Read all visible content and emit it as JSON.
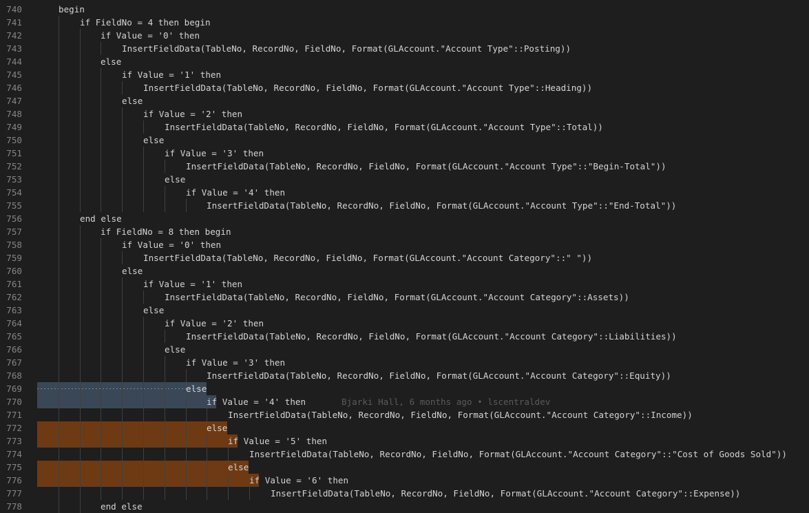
{
  "editor": {
    "lines": [
      {
        "n": "740",
        "indent": 1,
        "text": "begin"
      },
      {
        "n": "741",
        "indent": 2,
        "text": "if FieldNo = 4 then begin"
      },
      {
        "n": "742",
        "indent": 3,
        "text": "if Value = '0' then"
      },
      {
        "n": "743",
        "indent": 4,
        "text": "InsertFieldData(TableNo, RecordNo, FieldNo, Format(GLAccount.\"Account Type\"::Posting))"
      },
      {
        "n": "744",
        "indent": 3,
        "text": "else"
      },
      {
        "n": "745",
        "indent": 4,
        "text": "if Value = '1' then"
      },
      {
        "n": "746",
        "indent": 5,
        "text": "InsertFieldData(TableNo, RecordNo, FieldNo, Format(GLAccount.\"Account Type\"::Heading))"
      },
      {
        "n": "747",
        "indent": 4,
        "text": "else"
      },
      {
        "n": "748",
        "indent": 5,
        "text": "if Value = '2' then"
      },
      {
        "n": "749",
        "indent": 6,
        "text": "InsertFieldData(TableNo, RecordNo, FieldNo, Format(GLAccount.\"Account Type\"::Total))"
      },
      {
        "n": "750",
        "indent": 5,
        "text": "else"
      },
      {
        "n": "751",
        "indent": 6,
        "text": "if Value = '3' then"
      },
      {
        "n": "752",
        "indent": 7,
        "text": "InsertFieldData(TableNo, RecordNo, FieldNo, Format(GLAccount.\"Account Type\"::\"Begin-Total\"))"
      },
      {
        "n": "753",
        "indent": 6,
        "text": "else"
      },
      {
        "n": "754",
        "indent": 7,
        "text": "if Value = '4' then"
      },
      {
        "n": "755",
        "indent": 8,
        "text": "InsertFieldData(TableNo, RecordNo, FieldNo, Format(GLAccount.\"Account Type\"::\"End-Total\"))"
      },
      {
        "n": "756",
        "indent": 2,
        "text": "end else"
      },
      {
        "n": "757",
        "indent": 3,
        "text": "if FieldNo = 8 then begin"
      },
      {
        "n": "758",
        "indent": 4,
        "text": "if Value = '0' then"
      },
      {
        "n": "759",
        "indent": 5,
        "text": "InsertFieldData(TableNo, RecordNo, FieldNo, Format(GLAccount.\"Account Category\"::\" \"))"
      },
      {
        "n": "760",
        "indent": 4,
        "text": "else"
      },
      {
        "n": "761",
        "indent": 5,
        "text": "if Value = '1' then"
      },
      {
        "n": "762",
        "indent": 6,
        "text": "InsertFieldData(TableNo, RecordNo, FieldNo, Format(GLAccount.\"Account Category\"::Assets))"
      },
      {
        "n": "763",
        "indent": 5,
        "text": "else"
      },
      {
        "n": "764",
        "indent": 6,
        "text": "if Value = '2' then"
      },
      {
        "n": "765",
        "indent": 7,
        "text": "InsertFieldData(TableNo, RecordNo, FieldNo, Format(GLAccount.\"Account Category\"::Liabilities))"
      },
      {
        "n": "766",
        "indent": 6,
        "text": "else"
      },
      {
        "n": "767",
        "indent": 7,
        "text": "if Value = '3' then"
      },
      {
        "n": "768",
        "indent": 8,
        "text": "InsertFieldData(TableNo, RecordNo, FieldNo, Format(GLAccount.\"Account Category\"::Equity))"
      },
      {
        "n": "769",
        "indent": 7,
        "text": "else",
        "hl": "blame-dotted"
      },
      {
        "n": "770",
        "indent": 8,
        "text": "if Value = '4' then",
        "hl": "blame",
        "annotation": "Bjarki Hall, 6 months ago • lscentraldev"
      },
      {
        "n": "771",
        "indent": 9,
        "text": "InsertFieldData(TableNo, RecordNo, FieldNo, Format(GLAccount.\"Account Category\"::Income))"
      },
      {
        "n": "772",
        "indent": 8,
        "text": "else",
        "hl": "change"
      },
      {
        "n": "773",
        "indent": 9,
        "text": "if Value = '5' then",
        "hl": "change"
      },
      {
        "n": "774",
        "indent": 10,
        "text": "InsertFieldData(TableNo, RecordNo, FieldNo, Format(GLAccount.\"Account Category\"::\"Cost of Goods Sold\"))"
      },
      {
        "n": "775",
        "indent": 9,
        "text": "else",
        "hl": "change"
      },
      {
        "n": "776",
        "indent": 10,
        "text": "if Value = '6' then",
        "hl": "change"
      },
      {
        "n": "777",
        "indent": 11,
        "text": "InsertFieldData(TableNo, RecordNo, FieldNo, Format(GLAccount.\"Account Category\"::Expense))"
      },
      {
        "n": "778",
        "indent": 3,
        "text": "end else"
      }
    ]
  }
}
